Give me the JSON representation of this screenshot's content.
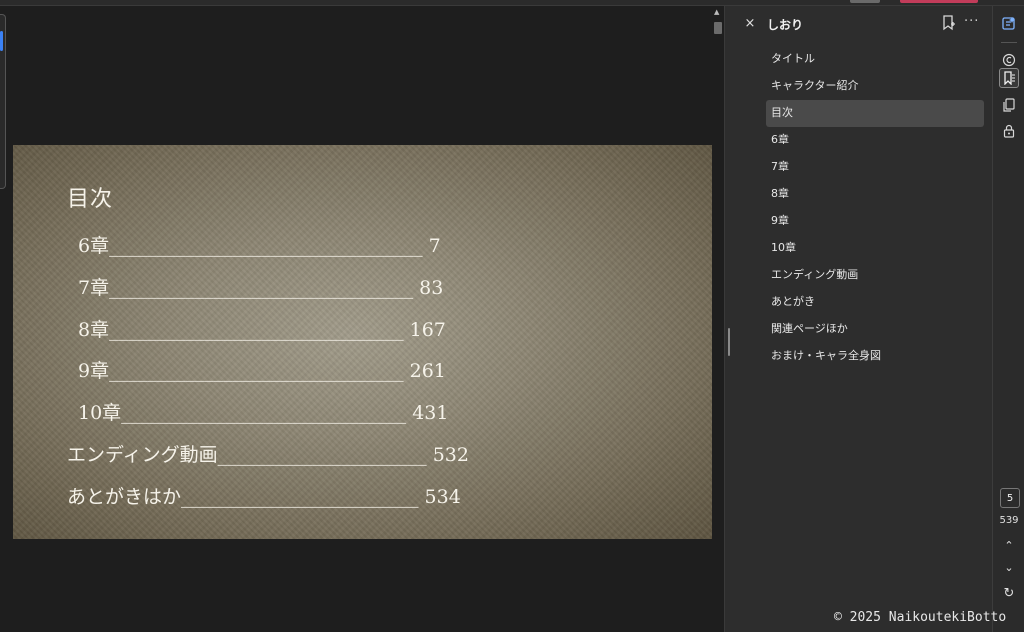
{
  "page": {
    "heading": "目次",
    "toc": [
      {
        "text": "6章_________________________________ 7"
      },
      {
        "text": "7章________________________________ 83"
      },
      {
        "text": "8章_______________________________ 167"
      },
      {
        "text": "9章_______________________________ 261"
      },
      {
        "text": "10章______________________________ 431"
      },
      {
        "text": "エンディング動画______________________ 532"
      },
      {
        "text": "あとがきはか_________________________ 534"
      }
    ]
  },
  "panel": {
    "title": "しおり",
    "close_symbol": "×",
    "more_symbol": "···",
    "bookmarks": [
      {
        "label": "タイトル"
      },
      {
        "label": "キャラクター紹介"
      },
      {
        "label": "目次",
        "selected": true
      },
      {
        "label": "6章"
      },
      {
        "label": "7章"
      },
      {
        "label": "8章"
      },
      {
        "label": "9章"
      },
      {
        "label": "10章"
      },
      {
        "label": "エンディング動画"
      },
      {
        "label": "あとがき"
      },
      {
        "label": "関連ページほか"
      },
      {
        "label": "おまけ・キャラ全身図"
      }
    ]
  },
  "rail": {
    "current_page": "5",
    "total_pages": "539",
    "up_symbol": "⌃",
    "down_symbol": "⌄",
    "rotate_symbol": "↻"
  },
  "footer": {
    "copyright": "© 2025 NaikoutekiBotto"
  },
  "colors": {
    "accent_blue": "#3b82f6",
    "tab_red": "#c23c5a",
    "panel_bg": "#2d2d2d",
    "selected_bg": "#4a4a4a"
  },
  "icons": [
    "close-icon",
    "add-bookmark-icon",
    "more-icon",
    "copilot-icon",
    "ai-summary-icon",
    "bookmark-icon",
    "pages-icon",
    "lock-icon",
    "chevron-up-icon",
    "chevron-down-icon",
    "rotate-icon"
  ]
}
